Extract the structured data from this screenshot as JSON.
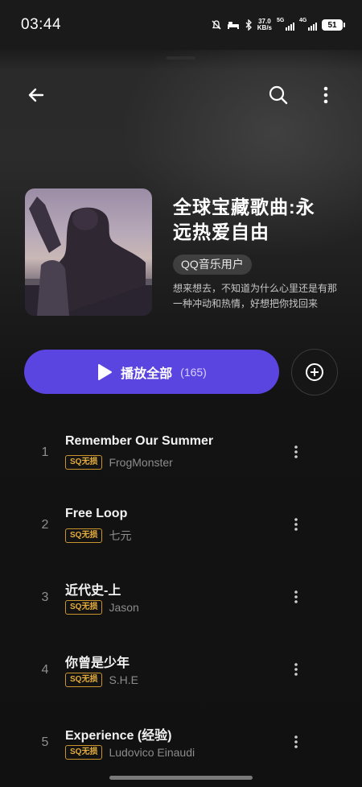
{
  "status_bar": {
    "time": "03:44",
    "net_speed_value": "37.0",
    "net_speed_unit": "KB/s",
    "signal1_label": "5G",
    "signal2_label": "4G",
    "battery": "51"
  },
  "playlist": {
    "title": "全球宝藏歌曲:永远热爱自由",
    "owner": "QQ音乐用户",
    "description": "想来想去，不知道为什么心里还是有那一种冲动和热情，好想把你找回来"
  },
  "actions": {
    "play_all_label": "播放全部",
    "play_all_count": "(165)"
  },
  "songs": [
    {
      "index": "1",
      "title": "Remember Our Summer",
      "badge": "SQ无损",
      "artist": "FrogMonster"
    },
    {
      "index": "2",
      "title": "Free Loop",
      "badge": "SQ无损",
      "artist": "七元"
    },
    {
      "index": "3",
      "title": "近代史-上",
      "badge": "SQ无损",
      "artist": "Jason"
    },
    {
      "index": "4",
      "title": "你曾是少年",
      "badge": "SQ无损",
      "artist": "S.H.E"
    },
    {
      "index": "5",
      "title": "Experience (经验)",
      "badge": "SQ无损",
      "artist": "Ludovico Einaudi"
    }
  ],
  "colors": {
    "accent": "#5b45e0",
    "badge": "#e3ac3d"
  }
}
